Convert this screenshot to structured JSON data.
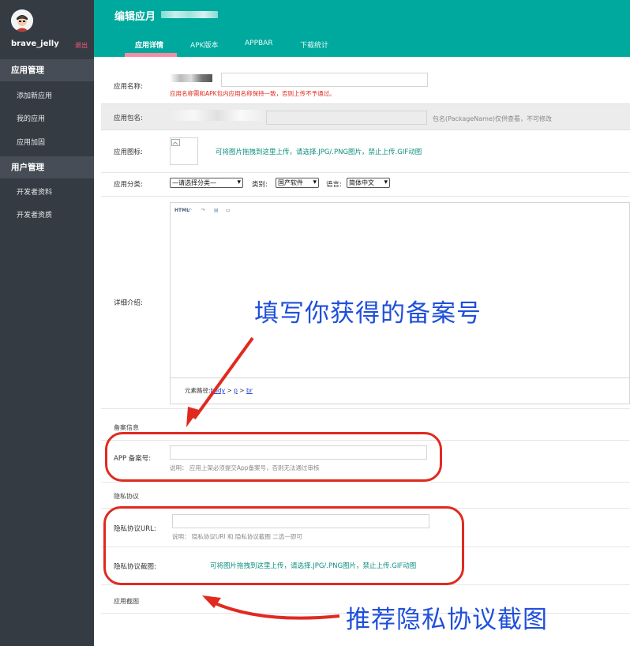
{
  "sidebar": {
    "username": "brave_jelly",
    "logout": "退出",
    "groups": [
      {
        "title": "应用管理",
        "items": [
          "添加新应用",
          "我的应用",
          "应用加固"
        ]
      },
      {
        "title": "用户管理",
        "items": [
          "开发者资料",
          "开发者资质"
        ]
      }
    ]
  },
  "header": {
    "title": "编辑应月",
    "tabs": [
      "应用详情",
      "APK版本",
      "APPBAR",
      "下载统计"
    ]
  },
  "form": {
    "app_name_label": "应用名称:",
    "app_name_hint": "应用名称需和APK包内应用名称保持一致，否则上传不予通过。",
    "package_label": "应用包名:",
    "package_hint": "包名(PackageName)仅供查看，不可修改",
    "icon_label": "应用图标:",
    "icon_hint": "可将图片拖拽到这里上传，请选择.JPG/.PNG图片，禁止上传.GIF动图",
    "category_label": "应用分类:",
    "category_select": "—请选择分类—",
    "type_label": "类别:",
    "type_select": "国产软件",
    "lang_label": "语言:",
    "lang_select": "简体中文",
    "detail_label": "详细介绍:",
    "editor_path_prefix": "元素路径:",
    "editor_path_body": "body",
    "editor_path_sep1": " > ",
    "editor_path_p": "p",
    "editor_path_sep2": " > ",
    "editor_path_br": "br",
    "beian_section": "备案信息",
    "beian_label": "APP 备案号:",
    "beian_hint": "说明：  应用上架必须提交App备案号，否则无法通过审核",
    "privacy_section": "隐私协议",
    "privacy_url_label": "隐私协议URL:",
    "privacy_url_hint": "说明：  隐私协议URl 和 隐私协议截图 二选一即可",
    "privacy_shot_label": "隐私协议截图:",
    "privacy_shot_hint": "可将图片拖拽到这里上传，请选择.JPG/.PNG图片，禁止上传.GIF动图",
    "screenshot_section": "应用截图"
  },
  "annotations": {
    "beian_callout": "填写你获得的备案号",
    "privacy_callout": "推荐隐私协议截图"
  },
  "colors": {
    "sidebar_bg": "#353b43",
    "header_bg": "#00a99d",
    "tab_underline": "#f58da6",
    "annotation_blue": "#1f4fdb",
    "annotation_red": "#e02a1f"
  }
}
